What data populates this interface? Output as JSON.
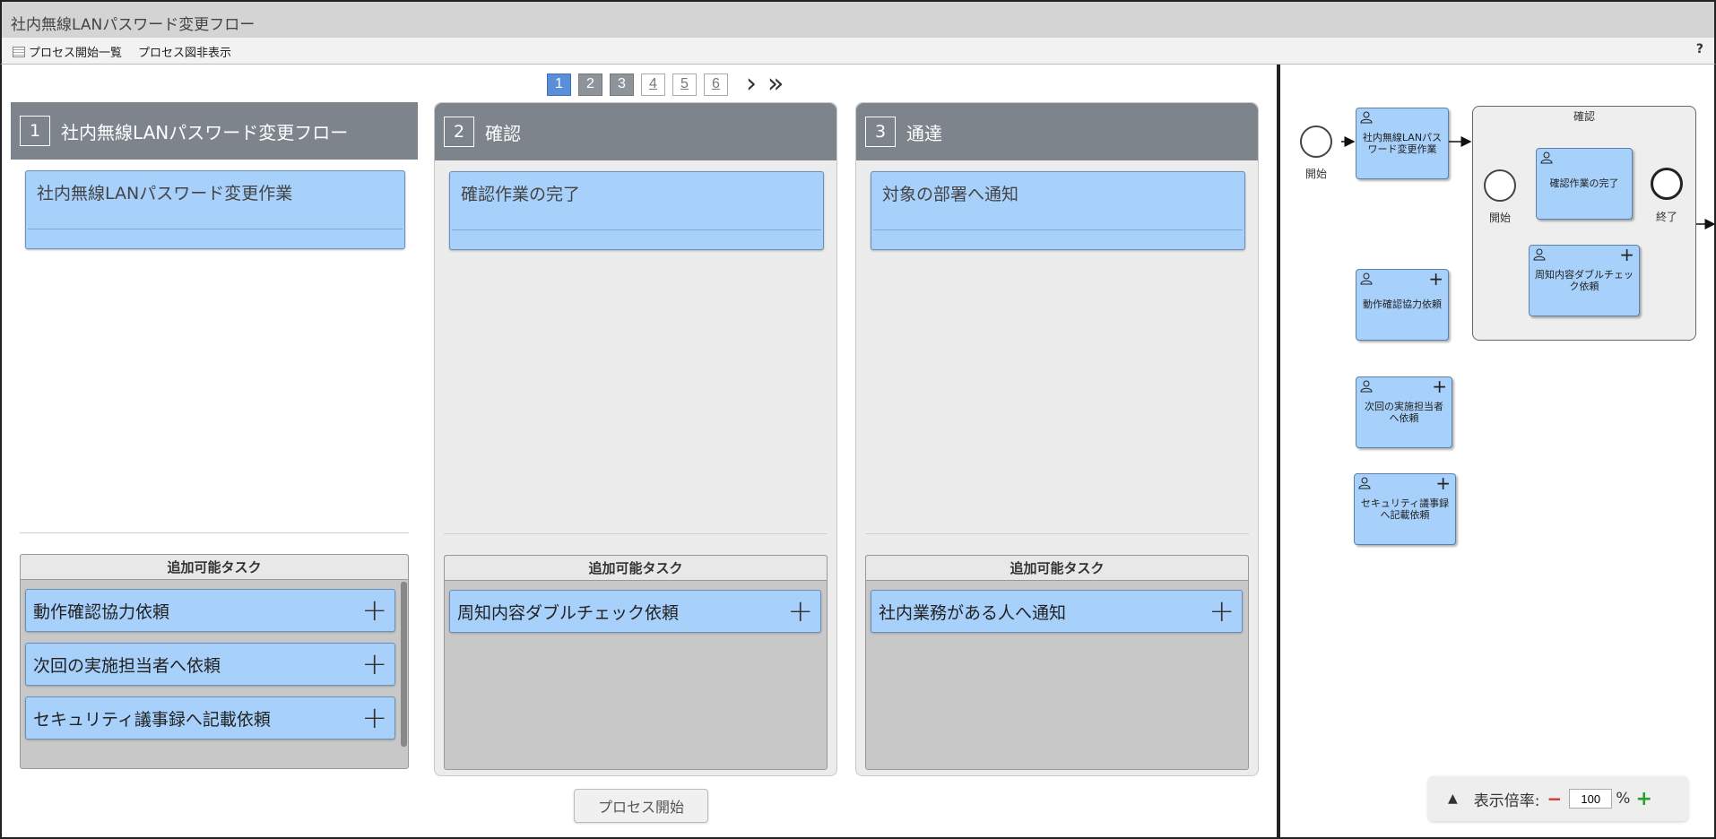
{
  "window": {
    "title": "社内無線LANパスワード変更フロー"
  },
  "toolbar": {
    "process_list": "プロセス開始一覧",
    "toggle_diagram": "プロセス図非表示",
    "help": "?"
  },
  "pager": {
    "pages": [
      "1",
      "2",
      "3",
      "4",
      "5",
      "6"
    ],
    "current": "1",
    "next": "›",
    "last": "»"
  },
  "columns": [
    {
      "num": "1",
      "title": "社内無線LANパスワード変更フロー",
      "task": "社内無線LANパスワード変更作業",
      "add_header": "追加可能タスク",
      "add_items": [
        "動作確認協力依頼",
        "次回の実施担当者へ依頼",
        "セキュリティ議事録へ記載依頼"
      ]
    },
    {
      "num": "2",
      "title": "確認",
      "task": "確認作業の完了",
      "add_header": "追加可能タスク",
      "add_items": [
        "周知内容ダブルチェック依頼"
      ]
    },
    {
      "num": "3",
      "title": "通達",
      "task": "対象の部署へ通知",
      "add_header": "追加可能タスク",
      "add_items": [
        "社内業務がある人へ通知"
      ]
    }
  ],
  "start_button": "プロセス開始",
  "diagram": {
    "start_label": "開始",
    "task_main": "社内無線LANパスワード変更作業",
    "subprocess_label": "確認",
    "sub_start_label": "開始",
    "sub_task": "確認作業の完了",
    "sub_end_label": "終了",
    "sub_add_task": "周知内容ダブルチェック依頼",
    "add_task_1": "動作確認協力依頼",
    "add_task_2": "次回の実施担当者へ依頼",
    "add_task_3": "セキュリティ議事録へ記載依頼"
  },
  "zoom": {
    "label": "表示倍率:",
    "value": "100",
    "unit": "%"
  },
  "colors": {
    "task_blue": "#a7d0fb",
    "header_gray": "#7d848c",
    "active_page": "#5a8ed8"
  }
}
